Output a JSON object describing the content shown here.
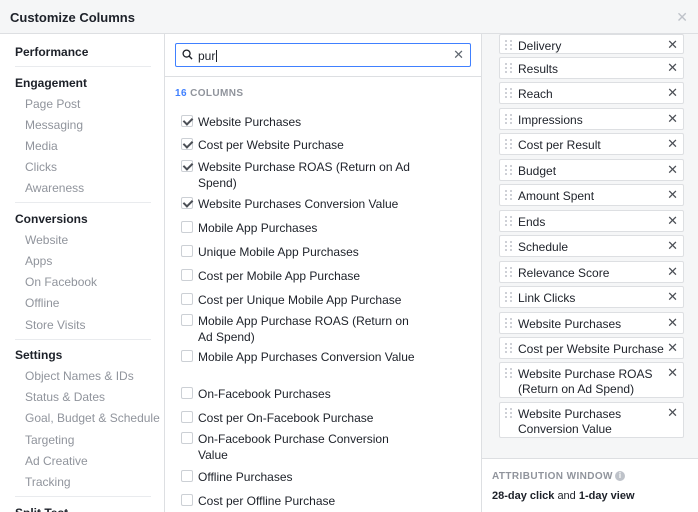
{
  "dialog": {
    "title": "Customize Columns"
  },
  "sidebar": {
    "sections": [
      {
        "title": "Performance",
        "items": []
      },
      {
        "title": "Engagement",
        "items": [
          "Page Post",
          "Messaging",
          "Media",
          "Clicks",
          "Awareness"
        ]
      },
      {
        "title": "Conversions",
        "items": [
          "Website",
          "Apps",
          "On Facebook",
          "Offline",
          "Store Visits"
        ]
      },
      {
        "title": "Settings",
        "items": [
          "Object Names & IDs",
          "Status & Dates",
          "Goal, Budget & Schedule",
          "Targeting",
          "Ad Creative",
          "Tracking"
        ]
      },
      {
        "title": "Split Test",
        "items": []
      }
    ]
  },
  "search": {
    "value": "pur",
    "icon": "search-icon"
  },
  "results": {
    "count": "16",
    "count_label": "COLUMNS",
    "options": [
      {
        "label": "Website Purchases",
        "checked": true
      },
      {
        "label": "Cost per Website Purchase",
        "checked": true
      },
      {
        "label": "Website Purchase ROAS (Return on Ad Spend)",
        "checked": true
      },
      {
        "label": "Website Purchases Conversion Value",
        "checked": true
      },
      {
        "label": "Mobile App Purchases",
        "checked": false
      },
      {
        "label": "Unique Mobile App Purchases",
        "checked": false
      },
      {
        "label": "Cost per Mobile App Purchase",
        "checked": false
      },
      {
        "label": "Cost per Unique Mobile App Purchase",
        "checked": false
      },
      {
        "label": "Mobile App Purchase ROAS (Return on Ad Spend)",
        "checked": false
      },
      {
        "label": "Mobile App Purchases Conversion Value",
        "checked": false
      },
      {
        "label": "On-Facebook Purchases",
        "checked": false
      },
      {
        "label": "Cost per On-Facebook Purchase",
        "checked": false
      },
      {
        "label": "On-Facebook Purchase Conversion Value",
        "checked": false
      },
      {
        "label": "Offline Purchases",
        "checked": false
      },
      {
        "label": "Cost per Offline Purchase",
        "checked": false
      }
    ]
  },
  "selected_columns": [
    "Delivery",
    "Results",
    "Reach",
    "Impressions",
    "Cost per Result",
    "Budget",
    "Amount Spent",
    "Ends",
    "Schedule",
    "Relevance Score",
    "Link Clicks",
    "Website Purchases",
    "Cost per Website Purchase",
    "Website Purchase ROAS (Return on Ad Spend)",
    "Website Purchases Conversion Value"
  ],
  "attribution": {
    "title": "ATTRIBUTION WINDOW",
    "click": "28-day click",
    "joiner": "and",
    "view": "1-day view"
  },
  "colors": {
    "accent": "#4080ff",
    "muted": "#90949c"
  }
}
